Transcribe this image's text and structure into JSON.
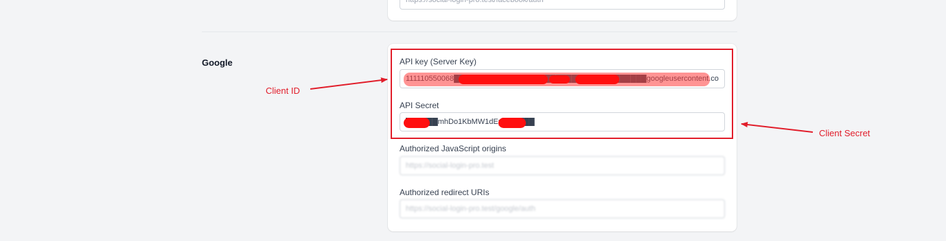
{
  "previous_section": {
    "redirect_value": "https://social-login-pro.test/facebook/auth"
  },
  "google": {
    "title": "Google",
    "api_key_label": "API key (Server Key)",
    "api_key_value": "111110550068████████████████████████████████████googleusercontent.com",
    "api_secret_label": "API Secret",
    "api_secret_value": "██████mhDo1KbMW1dEp██████",
    "js_origins_label": "Authorized JavaScript origins",
    "js_origins_value": "https://social-login-pro.test",
    "redirect_uris_label": "Authorized redirect URIs",
    "redirect_uris_value": "https://social-login-pro.test/google/auth"
  },
  "annotations": {
    "client_id": "Client ID",
    "client_secret": "Client Secret",
    "color": "#e11d2a"
  }
}
